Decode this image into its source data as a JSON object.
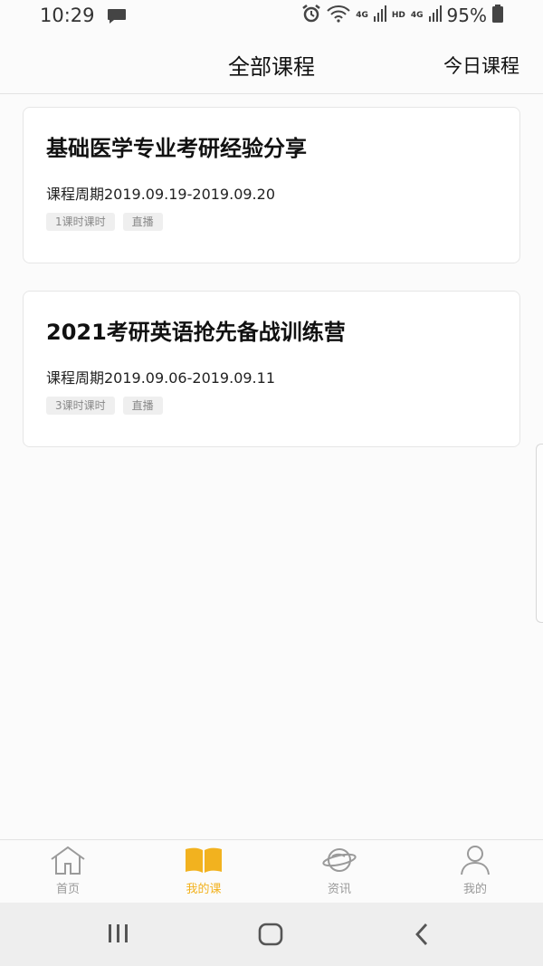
{
  "status_bar": {
    "time": "10:29",
    "network_4g": "4G",
    "hd": "HD",
    "battery": "95%"
  },
  "header": {
    "title": "全部课程",
    "today_link": "今日课程"
  },
  "courses": [
    {
      "title": "基础医学专业考研经验分享",
      "period": "课程周期2019.09.19-2019.09.20",
      "tags": [
        "1课时课时",
        "直播"
      ]
    },
    {
      "title": "2021考研英语抢先备战训练营",
      "period": "课程周期2019.09.06-2019.09.11",
      "tags": [
        "3课时课时",
        "直播"
      ]
    }
  ],
  "tab_bar": {
    "items": [
      {
        "label": "首页",
        "icon": "home-icon"
      },
      {
        "label": "我的课",
        "icon": "book-icon",
        "active": true
      },
      {
        "label": "资讯",
        "icon": "planet-icon"
      },
      {
        "label": "我的",
        "icon": "person-icon"
      }
    ],
    "active_color": "#f2b21f",
    "inactive_color": "#999999"
  },
  "nav_bar": {
    "buttons": [
      "recent-apps-icon",
      "home-circle-icon",
      "back-icon"
    ]
  }
}
